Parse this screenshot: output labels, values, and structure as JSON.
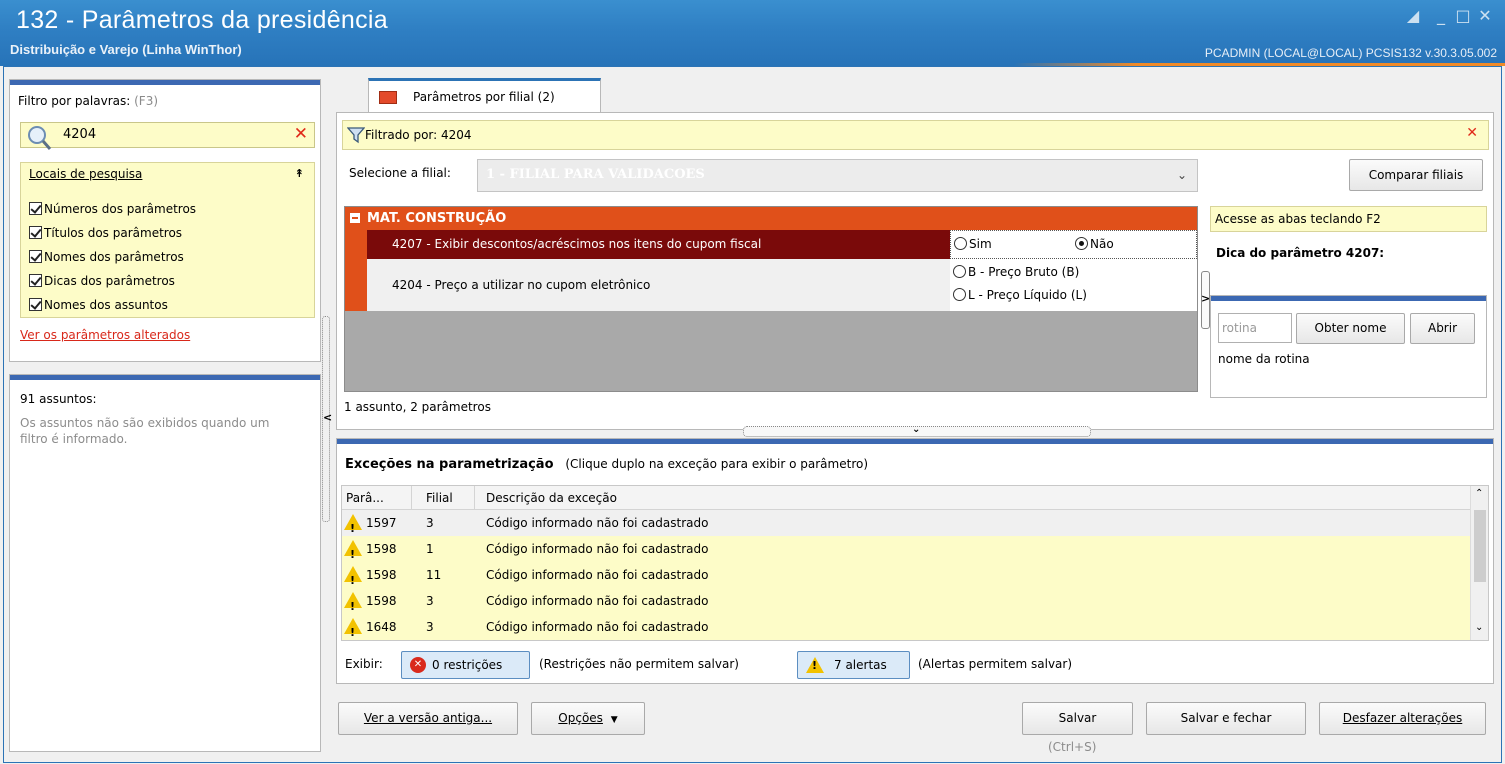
{
  "window": {
    "title": "132 - Parâmetros da presidência",
    "subtitle": "Distribuição e Varejo (Linha WinThor)",
    "user_info": "PCADMIN (LOCAL@LOCAL)  PCSIS132  v.30.3.05.002"
  },
  "sidebar": {
    "filter_label": "Filtro por palavras:",
    "filter_hotkey": "(F3)",
    "filter_value": "4204",
    "search_locations": {
      "title": "Locais de pesquisa",
      "items": [
        {
          "label": "Números dos parâmetros",
          "checked": true
        },
        {
          "label": "Títulos dos parâmetros",
          "checked": true
        },
        {
          "label": "Nomes dos parâmetros",
          "checked": true
        },
        {
          "label": "Dicas dos parâmetros",
          "checked": true
        },
        {
          "label": "Nomes dos assuntos",
          "checked": true
        }
      ]
    },
    "changed_link": "Ver os parâmetros alterados",
    "subjects_count": "91 assuntos:",
    "subjects_note": "Os assuntos não são exibidos quando um filtro é informado."
  },
  "tab": {
    "label": "Parâmetros por filial",
    "count": "(2)"
  },
  "filter_bar": {
    "text": "Filtrado por: 4204"
  },
  "branch": {
    "label": "Selecione a filial:",
    "value": "1 - FILIAL PARA VALIDACOES",
    "compare_button": "Comparar filiais"
  },
  "params": {
    "group": "MAT. CONSTRUÇÃO",
    "rows": [
      {
        "label": "4207 - Exibir descontos/acréscimos nos itens do cupom fiscal",
        "options": [
          "Sim",
          "Não"
        ],
        "selected": "Não"
      },
      {
        "label": "4204 - Preço a utilizar no cupom eletrônico",
        "options": [
          "B - Preço Bruto (B)",
          "L - Preço Líquido (L)"
        ],
        "selected": ""
      }
    ],
    "summary": "1 assunto, 2 parâmetros"
  },
  "help": {
    "hint": "Acesse as abas teclando F2",
    "title": "Dica do parâmetro 4207:",
    "routine_placeholder": "rotina",
    "get_name_button": "Obter nome",
    "open_button": "Abrir",
    "routine_name": "nome da rotina"
  },
  "exceptions": {
    "title": "Exceções na parametrização",
    "subtitle": "(Clique duplo na exceção para exibir o parâmetro)",
    "columns": [
      "Parâ...",
      "Filial",
      "Descrição da exceção"
    ],
    "rows": [
      {
        "param": "1597",
        "branch": "3",
        "desc": "Código informado não foi cadastrado"
      },
      {
        "param": "1598",
        "branch": "1",
        "desc": "Código informado não foi cadastrado"
      },
      {
        "param": "1598",
        "branch": "11",
        "desc": "Código informado não foi cadastrado"
      },
      {
        "param": "1598",
        "branch": "3",
        "desc": "Código informado não foi cadastrado"
      },
      {
        "param": "1648",
        "branch": "3",
        "desc": "Código informado não foi cadastrado"
      }
    ],
    "show_label": "Exibir:",
    "restrictions_button": "0 restrições",
    "restrictions_note": "(Restrições não permitem salvar)",
    "alerts_button": "7 alertas",
    "alerts_note": "(Alertas permitem salvar)"
  },
  "footer": {
    "old_version": "Ver a versão antiga...",
    "options": "Opções",
    "save": "Salvar",
    "save_hotkey": "(Ctrl+S)",
    "save_close": "Salvar e fechar",
    "undo": "Desfazer alterações"
  },
  "colors": {
    "title_blue": "#2f7fc3",
    "group_orange": "#e0501a",
    "selected_row": "#7a0a0a",
    "warning_yellow": "#fdfcc8"
  }
}
